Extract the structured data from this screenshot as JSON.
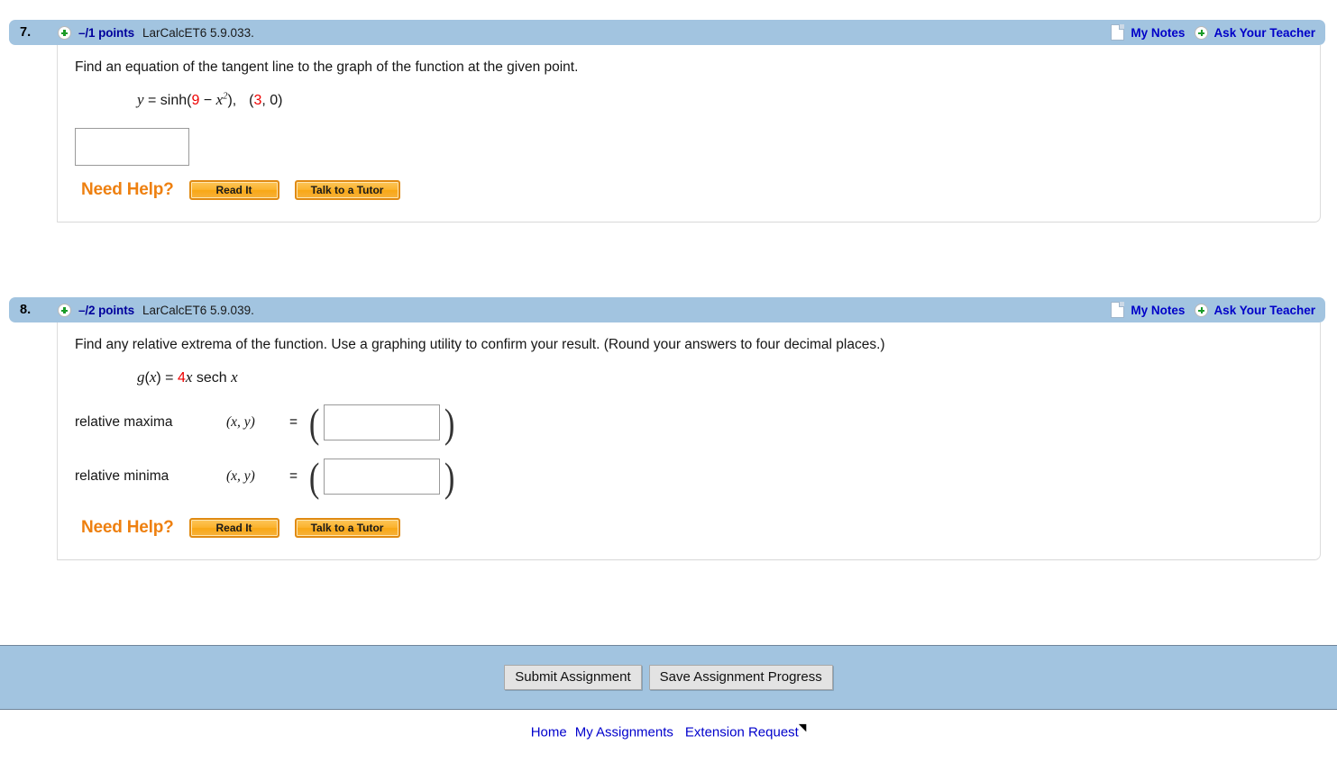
{
  "questions": [
    {
      "number": "7.",
      "points": "–/1 points",
      "code": "LarCalcET6 5.9.033.",
      "my_notes": "My Notes",
      "ask_teacher": "Ask Your Teacher",
      "prompt": "Find an equation of the tangent line to the graph of the function at the given point.",
      "math": {
        "lhs": "y",
        "eq": "=",
        "fn": "sinh(",
        "num1": "9",
        "minus": "−",
        "var": "x",
        "exponent": "2",
        "close": "),",
        "point_open": "(",
        "num2": "3",
        "point_rest": ", 0)"
      },
      "answer_value": "",
      "answer_placeholder": "",
      "need_help_label": "Need Help?",
      "read_it_label": "Read It",
      "tutor_label": "Talk to a Tutor"
    },
    {
      "number": "8.",
      "points": "–/2 points",
      "code": "LarCalcET6 5.9.039.",
      "my_notes": "My Notes",
      "ask_teacher": "Ask Your Teacher",
      "prompt": "Find any relative extrema of the function. Use a graphing utility to confirm your result. (Round your answers to four decimal places.)",
      "math": {
        "lhs": "g",
        "lparen": "(",
        "arg": "x",
        "rparen": ")",
        "eq": "=",
        "coef": "4",
        "var": "x",
        "rest": "sech",
        "var2": "x"
      },
      "rows": [
        {
          "label": "relative maxima",
          "xy": "(x, y)",
          "eq": "=",
          "value": "",
          "open": "(",
          "close": ")"
        },
        {
          "label": "relative minima",
          "xy": "(x, y)",
          "eq": "=",
          "value": "",
          "open": "(",
          "close": ")"
        }
      ],
      "need_help_label": "Need Help?",
      "read_it_label": "Read It",
      "tutor_label": "Talk to a Tutor"
    }
  ],
  "footer": {
    "submit_label": "Submit Assignment",
    "save_label": "Save Assignment Progress",
    "links": [
      {
        "label": "Home"
      },
      {
        "label": "My Assignments"
      },
      {
        "label": "Extension Request"
      }
    ],
    "extension_mark": "◥"
  },
  "colors": {
    "header_blue": "#a2c4e0",
    "link_blue": "#0000c8",
    "accent_orange": "#ee8010",
    "math_red": "#ee0000"
  }
}
